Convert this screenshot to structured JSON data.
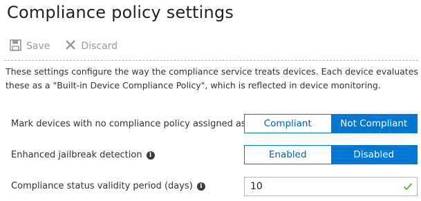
{
  "header": {
    "title": "Compliance policy settings"
  },
  "toolbar": {
    "save_label": "Save",
    "discard_label": "Discard"
  },
  "description": "These settings configure the way the compliance service treats devices. Each device evaluates these as a \"Built-in Device Compliance Policy\", which is reflected in device monitoring.",
  "settings": {
    "no_policy": {
      "label": "Mark devices with no compliance policy assigned as",
      "options": [
        "Compliant",
        "Not Compliant"
      ],
      "selected": "Not Compliant"
    },
    "jailbreak": {
      "label": "Enhanced jailbreak detection",
      "options": [
        "Enabled",
        "Disabled"
      ],
      "selected": "Disabled"
    },
    "validity": {
      "label": "Compliance status validity period (days)",
      "value": "10"
    }
  },
  "colors": {
    "accent": "#0078d4",
    "check": "#57a64a"
  },
  "icons": {
    "save": "save-icon",
    "discard": "discard-icon",
    "info": "info-icon",
    "valid": "checkmark-icon"
  }
}
